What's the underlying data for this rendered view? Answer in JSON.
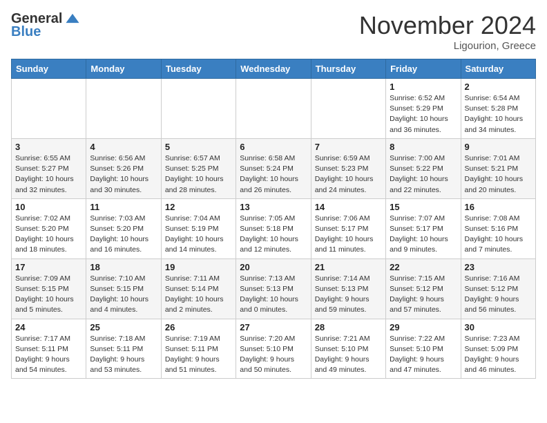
{
  "logo": {
    "general": "General",
    "blue": "Blue"
  },
  "header": {
    "month": "November 2024",
    "location": "Ligourion, Greece"
  },
  "weekdays": [
    "Sunday",
    "Monday",
    "Tuesday",
    "Wednesday",
    "Thursday",
    "Friday",
    "Saturday"
  ],
  "weeks": [
    [
      {
        "day": "",
        "info": ""
      },
      {
        "day": "",
        "info": ""
      },
      {
        "day": "",
        "info": ""
      },
      {
        "day": "",
        "info": ""
      },
      {
        "day": "",
        "info": ""
      },
      {
        "day": "1",
        "info": "Sunrise: 6:52 AM\nSunset: 5:29 PM\nDaylight: 10 hours and 36 minutes."
      },
      {
        "day": "2",
        "info": "Sunrise: 6:54 AM\nSunset: 5:28 PM\nDaylight: 10 hours and 34 minutes."
      }
    ],
    [
      {
        "day": "3",
        "info": "Sunrise: 6:55 AM\nSunset: 5:27 PM\nDaylight: 10 hours and 32 minutes."
      },
      {
        "day": "4",
        "info": "Sunrise: 6:56 AM\nSunset: 5:26 PM\nDaylight: 10 hours and 30 minutes."
      },
      {
        "day": "5",
        "info": "Sunrise: 6:57 AM\nSunset: 5:25 PM\nDaylight: 10 hours and 28 minutes."
      },
      {
        "day": "6",
        "info": "Sunrise: 6:58 AM\nSunset: 5:24 PM\nDaylight: 10 hours and 26 minutes."
      },
      {
        "day": "7",
        "info": "Sunrise: 6:59 AM\nSunset: 5:23 PM\nDaylight: 10 hours and 24 minutes."
      },
      {
        "day": "8",
        "info": "Sunrise: 7:00 AM\nSunset: 5:22 PM\nDaylight: 10 hours and 22 minutes."
      },
      {
        "day": "9",
        "info": "Sunrise: 7:01 AM\nSunset: 5:21 PM\nDaylight: 10 hours and 20 minutes."
      }
    ],
    [
      {
        "day": "10",
        "info": "Sunrise: 7:02 AM\nSunset: 5:20 PM\nDaylight: 10 hours and 18 minutes."
      },
      {
        "day": "11",
        "info": "Sunrise: 7:03 AM\nSunset: 5:20 PM\nDaylight: 10 hours and 16 minutes."
      },
      {
        "day": "12",
        "info": "Sunrise: 7:04 AM\nSunset: 5:19 PM\nDaylight: 10 hours and 14 minutes."
      },
      {
        "day": "13",
        "info": "Sunrise: 7:05 AM\nSunset: 5:18 PM\nDaylight: 10 hours and 12 minutes."
      },
      {
        "day": "14",
        "info": "Sunrise: 7:06 AM\nSunset: 5:17 PM\nDaylight: 10 hours and 11 minutes."
      },
      {
        "day": "15",
        "info": "Sunrise: 7:07 AM\nSunset: 5:17 PM\nDaylight: 10 hours and 9 minutes."
      },
      {
        "day": "16",
        "info": "Sunrise: 7:08 AM\nSunset: 5:16 PM\nDaylight: 10 hours and 7 minutes."
      }
    ],
    [
      {
        "day": "17",
        "info": "Sunrise: 7:09 AM\nSunset: 5:15 PM\nDaylight: 10 hours and 5 minutes."
      },
      {
        "day": "18",
        "info": "Sunrise: 7:10 AM\nSunset: 5:15 PM\nDaylight: 10 hours and 4 minutes."
      },
      {
        "day": "19",
        "info": "Sunrise: 7:11 AM\nSunset: 5:14 PM\nDaylight: 10 hours and 2 minutes."
      },
      {
        "day": "20",
        "info": "Sunrise: 7:13 AM\nSunset: 5:13 PM\nDaylight: 10 hours and 0 minutes."
      },
      {
        "day": "21",
        "info": "Sunrise: 7:14 AM\nSunset: 5:13 PM\nDaylight: 9 hours and 59 minutes."
      },
      {
        "day": "22",
        "info": "Sunrise: 7:15 AM\nSunset: 5:12 PM\nDaylight: 9 hours and 57 minutes."
      },
      {
        "day": "23",
        "info": "Sunrise: 7:16 AM\nSunset: 5:12 PM\nDaylight: 9 hours and 56 minutes."
      }
    ],
    [
      {
        "day": "24",
        "info": "Sunrise: 7:17 AM\nSunset: 5:11 PM\nDaylight: 9 hours and 54 minutes."
      },
      {
        "day": "25",
        "info": "Sunrise: 7:18 AM\nSunset: 5:11 PM\nDaylight: 9 hours and 53 minutes."
      },
      {
        "day": "26",
        "info": "Sunrise: 7:19 AM\nSunset: 5:11 PM\nDaylight: 9 hours and 51 minutes."
      },
      {
        "day": "27",
        "info": "Sunrise: 7:20 AM\nSunset: 5:10 PM\nDaylight: 9 hours and 50 minutes."
      },
      {
        "day": "28",
        "info": "Sunrise: 7:21 AM\nSunset: 5:10 PM\nDaylight: 9 hours and 49 minutes."
      },
      {
        "day": "29",
        "info": "Sunrise: 7:22 AM\nSunset: 5:10 PM\nDaylight: 9 hours and 47 minutes."
      },
      {
        "day": "30",
        "info": "Sunrise: 7:23 AM\nSunset: 5:09 PM\nDaylight: 9 hours and 46 minutes."
      }
    ]
  ]
}
